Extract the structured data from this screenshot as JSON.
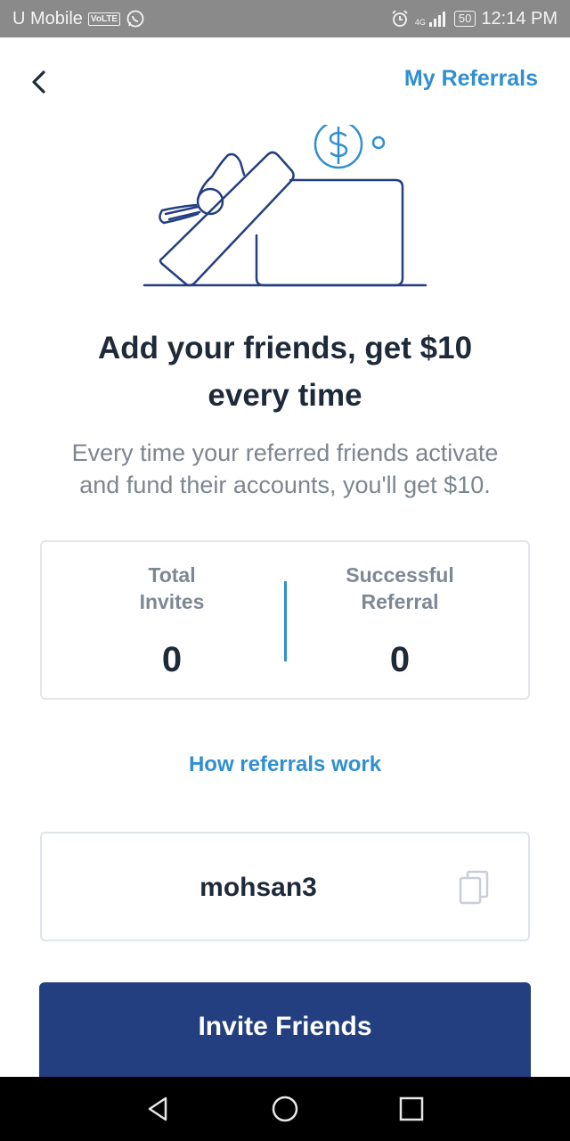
{
  "status_bar": {
    "carrier": "U Mobile",
    "volte_badge": "VoLTE",
    "network_label": "4G",
    "battery": "50",
    "time": "12:14 PM"
  },
  "header": {
    "my_referrals_label": "My Referrals"
  },
  "hero": {
    "headline_line1": "Add your friends, get $10",
    "headline_line2": "every time",
    "subtext_line1": "Every time your referred friends activate",
    "subtext_line2": "and fund their accounts, you'll get $10."
  },
  "stats": {
    "total_invites_line1": "Total",
    "total_invites_line2": "Invites",
    "total_invites_value": "0",
    "successful_line1": "Successful",
    "successful_line2": "Referral",
    "successful_value": "0"
  },
  "how_link_label": "How referrals work",
  "referral_code": {
    "code": "mohsan3"
  },
  "invite_button_label": "Invite Friends",
  "icons": {
    "back": "chevron-left-icon",
    "copy": "copy-icon",
    "illustration": "gift-box-dollar-illustration",
    "nav_back": "triangle-back-icon",
    "nav_home": "circle-home-icon",
    "nav_recent": "square-recents-icon"
  },
  "colors": {
    "accent_blue": "#2f8fd1",
    "button_navy": "#233f80",
    "text_dark": "#1e2a3a",
    "text_muted": "#7d8590",
    "status_bar": "#8a8a8a"
  }
}
